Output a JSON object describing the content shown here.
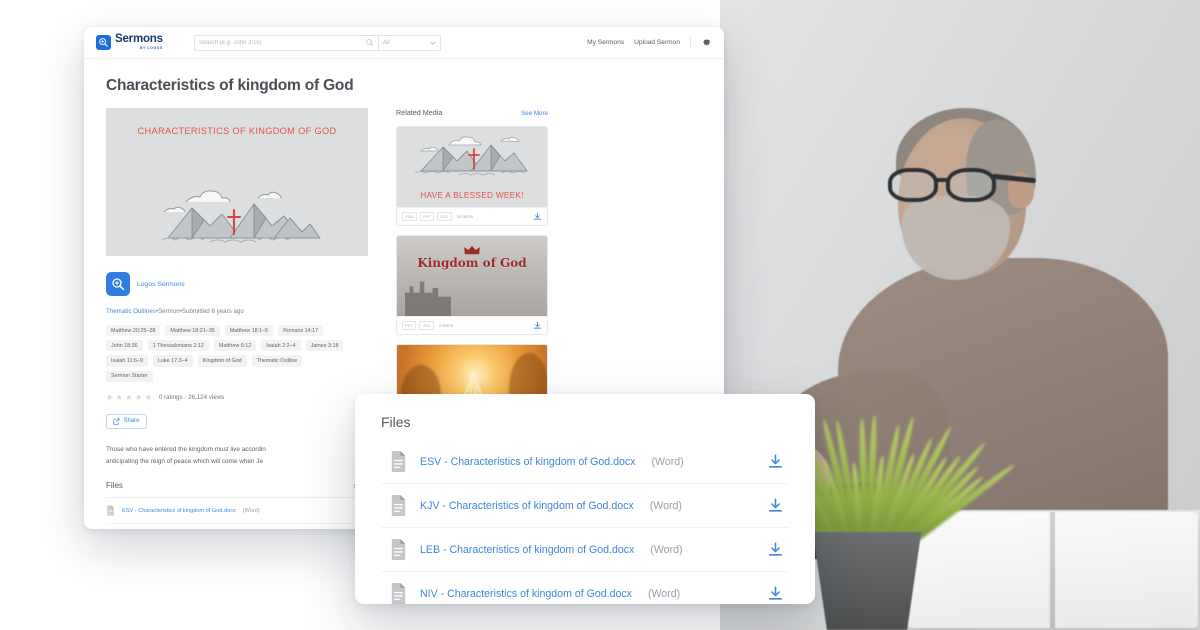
{
  "header": {
    "logo_main": "Sermons",
    "logo_sub": "BY LOGOS",
    "logo_icon": "magnifier-plus-icon",
    "search_placeholder": "Search (e.g. John 3:16)",
    "search_value": "",
    "search_icon": "search-icon",
    "filter_value": "All",
    "filter_icon": "chevron-down-icon",
    "links": [
      {
        "label": "My Sermons"
      },
      {
        "label": "Upload Sermon"
      }
    ],
    "settings_icon": "gear-icon"
  },
  "page": {
    "title": "Characteristics of kingdom of God",
    "hero_title": "CHARACTERISTICS OF KINGDOM OF GOD",
    "hero_art": "mountains-with-cross-illustration"
  },
  "author": {
    "name": "Logos Sermons",
    "avatar_icon": "logos-sermons-badge-icon"
  },
  "meta": {
    "category": "Thematic Outlines",
    "sep1": "•",
    "type": "Sermon",
    "sep2": "•",
    "submitted": "Submitted 6 years ago"
  },
  "tags": [
    "Matthew 20:25–28",
    "Matthew 18:21–35",
    "Matthew 18:1–5",
    "Romans 14:17",
    "John 18:36",
    "1 Thessalonians 2:12",
    "Matthew 6:12",
    "Isaiah 2:2–4",
    "James 3:18",
    "Isaiah 11:6–9",
    "Luke 17:3–4",
    "Kingdom of God",
    "Thematic Outline",
    "Sermon Starter"
  ],
  "rating": {
    "stars_total": 5,
    "stars_filled": 0,
    "summary": "0 ratings · 26,124 views",
    "ratings_count": "0 ratings",
    "views_count": "26,124 views"
  },
  "share": {
    "label": "Share",
    "icon": "share-external-icon"
  },
  "description": {
    "line1": "Those who have entered the kingdom must live accordin",
    "line2": "anticipating the reign of peace which will come when Je"
  },
  "files_section": {
    "title": "Files",
    "action_label": "Star",
    "rows": [
      {
        "name": "ESV - Characteristics of kingdom of God.docx",
        "kind": "(Word)",
        "icon": "document-icon"
      }
    ]
  },
  "related_media": {
    "title": "Related Media",
    "see_more": "See More",
    "cards": [
      {
        "caption": "HAVE A BLESSED WEEK!",
        "art": "mountains-with-cross-illustration",
        "formats": [
          "PSD",
          "PPT",
          "JPG"
        ],
        "items": "16 items",
        "download_icon": "download-icon"
      },
      {
        "caption": "Kingdom of God",
        "art": "castle-landscape-photo",
        "formats": [
          "PPT",
          "JPG"
        ],
        "items": "4 items",
        "download_icon": "download-icon"
      },
      {
        "caption": "",
        "art": "golden-sunrays-forest-photo",
        "formats": [],
        "items": "",
        "download_icon": "download-icon"
      }
    ]
  },
  "files_modal": {
    "title": "Files",
    "rows": [
      {
        "name": "ESV - Characteristics of kingdom of God.docx",
        "kind": "(Word)",
        "file_icon": "document-icon",
        "download_icon": "download-icon"
      },
      {
        "name": "KJV - Characteristics of kingdom of God.docx",
        "kind": "(Word)",
        "file_icon": "document-icon",
        "download_icon": "download-icon"
      },
      {
        "name": "LEB - Characteristics of kingdom of God.docx",
        "kind": "(Word)",
        "file_icon": "document-icon",
        "download_icon": "download-icon"
      },
      {
        "name": "NIV - Characteristics of kingdom of God.docx",
        "kind": "(Word)",
        "file_icon": "document-icon",
        "download_icon": "download-icon"
      }
    ]
  },
  "photo": {
    "description": "man-with-glasses-at-laptop-with-open-book-photo"
  },
  "colors": {
    "accent_blue": "#3f86dc",
    "logo_blue": "#1d6ddb",
    "hero_red": "#e0564a",
    "text_dark": "#4a4f55",
    "text_muted": "#9aa0a6",
    "tag_bg": "#f1f3f4"
  }
}
